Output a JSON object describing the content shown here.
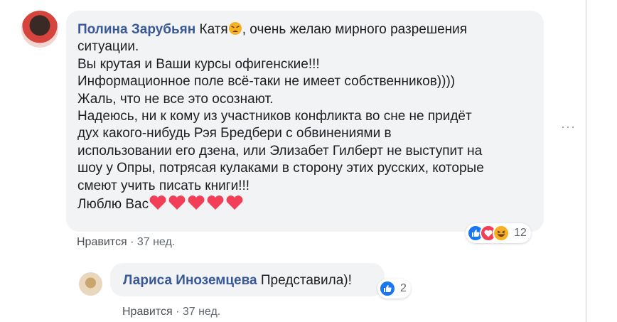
{
  "comment": {
    "author": "Полина Зарубьян",
    "lines": [
      "Катя",
      ", очень желаю мирного разрешения",
      "ситуации.",
      "Вы крутая и Ваши курсы офигенские!!!",
      "Информационное поле всё-таки не имеет собственников))))",
      "Жаль, что не все это осознают.",
      "Надеюсь, ни к кому из участников конфликта во сне не придёт",
      "дух какого-нибудь Рэя Бредбери с обвинениями в",
      "использовании его дзена, или Элизабет Гилберт не выступит на",
      "шоу у Опры, потрясая кулаками в сторону этих русских, которые",
      "смеют учить писать книги!!!",
      "Люблю Вас"
    ],
    "like_label": "Нравится",
    "separator": "·",
    "time": "37 нед.",
    "reaction_count": "12",
    "reactions": [
      "like-icon",
      "love-icon",
      "haha-icon"
    ]
  },
  "reply": {
    "author": "Лариса Иноземцева",
    "text": "Представила)!",
    "like_label": "Нравится",
    "separator": "·",
    "time": "37 нед.",
    "reaction_count": "2",
    "reactions": [
      "like-icon"
    ]
  },
  "colors": {
    "author": "#385898",
    "bubble": "#f2f3f5",
    "meta": "#606770",
    "heart": "#f33e58"
  }
}
